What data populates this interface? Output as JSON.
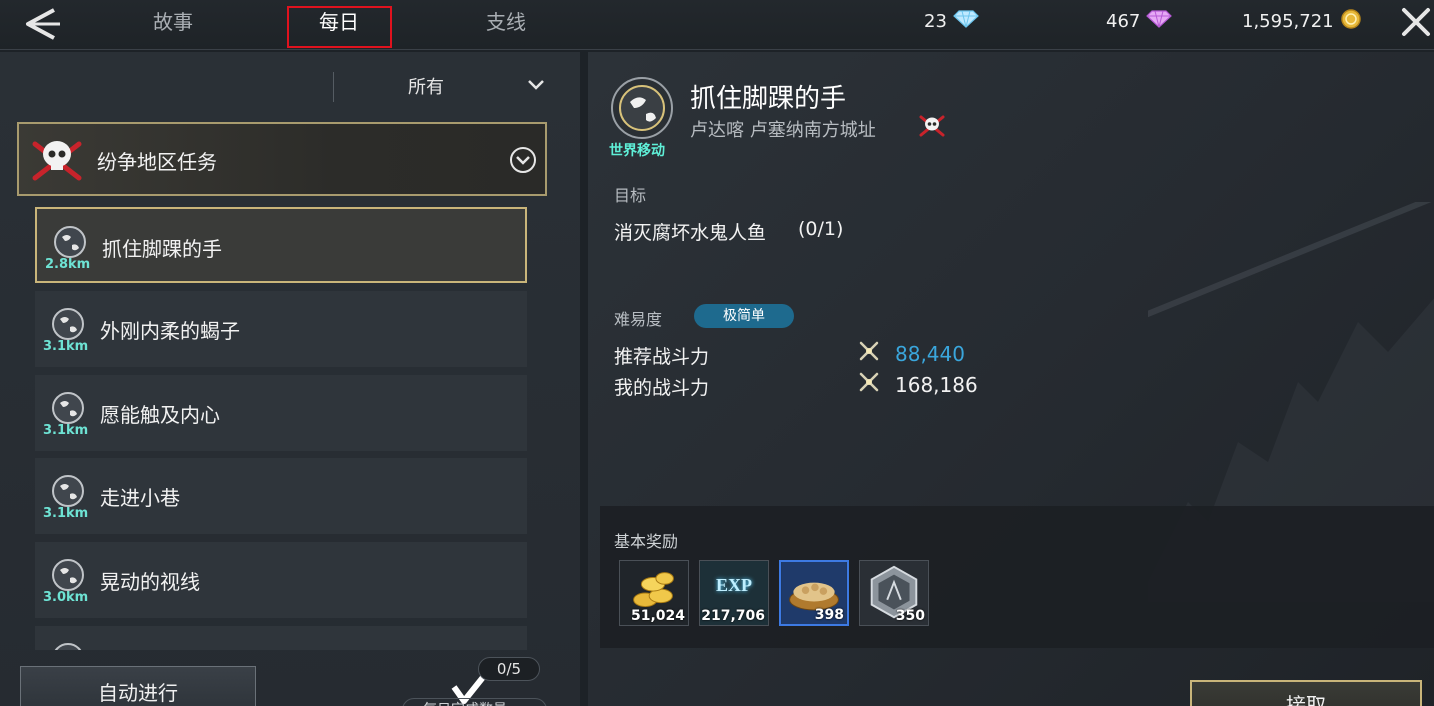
{
  "header": {
    "tabs": [
      {
        "label": "故事"
      },
      {
        "label": "每日"
      },
      {
        "label": "支线"
      }
    ],
    "currencies": [
      {
        "value": "23",
        "icon": "blue-diamond-icon"
      },
      {
        "value": "467",
        "icon": "purple-diamond-icon"
      },
      {
        "value": "1,595,721",
        "icon": "gold-coin-icon"
      }
    ]
  },
  "sidebar": {
    "filter_label": "所有",
    "category_label": "纷争地区任务",
    "quests": [
      {
        "title": "抓住脚踝的手",
        "distance": "2.8km"
      },
      {
        "title": "外刚内柔的蝎子",
        "distance": "3.1km"
      },
      {
        "title": "愿能触及内心",
        "distance": "3.1km"
      },
      {
        "title": "走进小巷",
        "distance": "3.1km"
      },
      {
        "title": "晃动的视线",
        "distance": "3.0km"
      }
    ],
    "auto_button_label": "自动进行",
    "daily_count": "0/5",
    "daily_label": "每日完成数量"
  },
  "detail": {
    "travel_label": "世界移动",
    "quest_title": "抓住脚踝的手",
    "location": "卢达喀 卢塞纳南方城址",
    "objective_title": "目标",
    "objective_text": "消灭腐坏水鬼人鱼",
    "objective_progress": "(0/1)",
    "difficulty_title": "难易度",
    "difficulty_badge": "极简单",
    "recommended_power_label": "推荐战斗力",
    "recommended_power_value": "88,440",
    "my_power_label": "我的战斗力",
    "my_power_value": "168,186",
    "rewards_title": "基本奖励",
    "rewards": [
      {
        "type": "gold-coins-icon",
        "qty": "51,024"
      },
      {
        "type": "exp-icon",
        "qty": "217,706",
        "art_text": "EXP"
      },
      {
        "type": "food-bowl-icon",
        "qty": "398"
      },
      {
        "type": "emblem-icon",
        "qty": "350"
      }
    ],
    "accept_button_label": "接取"
  },
  "colors": {
    "tab_highlight": "#e0121e",
    "recommended_power": "#3aa6dc",
    "my_power": "#f2f2f2",
    "distance": "#6ee3d4",
    "travel": "#5ff0d8",
    "difficulty_badge": "#1e6a8e",
    "selection_gold": "#c9b57a"
  }
}
